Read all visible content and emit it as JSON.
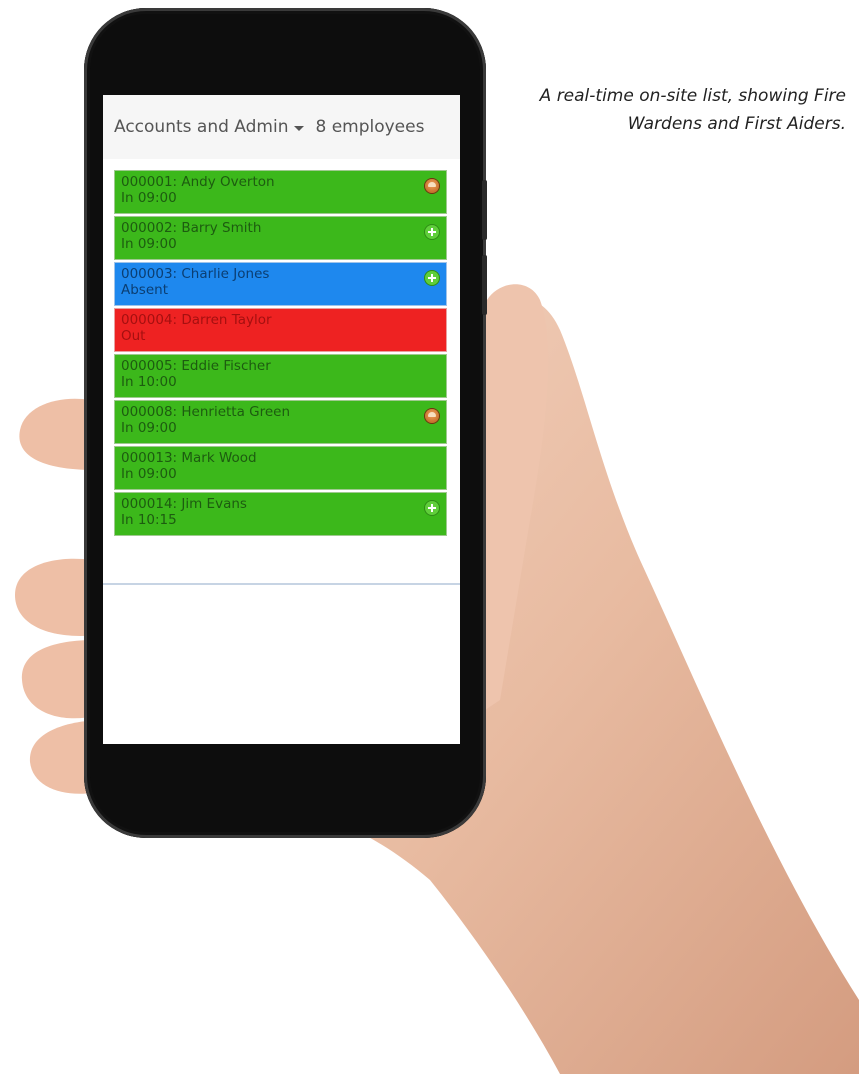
{
  "caption": "A real-time on-site list, showing Fire Wardens and First Aiders.",
  "header": {
    "department": "Accounts and Admin",
    "employee_count": "8 employees"
  },
  "employees": [
    {
      "name": "000001: Andy Overton",
      "status_text": "In 09:00",
      "state": "in",
      "role_icon": "fire-warden-icon"
    },
    {
      "name": "000002: Barry Smith",
      "status_text": "In 09:00",
      "state": "in",
      "role_icon": "first-aid-icon"
    },
    {
      "name": "000003: Charlie Jones",
      "status_text": "Absent",
      "state": "absent",
      "role_icon": "first-aid-icon"
    },
    {
      "name": "000004: Darren Taylor",
      "status_text": "Out",
      "state": "out",
      "role_icon": ""
    },
    {
      "name": "000005: Eddie Fischer",
      "status_text": "In 10:00",
      "state": "in",
      "role_icon": ""
    },
    {
      "name": "000008: Henrietta Green",
      "status_text": "In 09:00",
      "state": "in",
      "role_icon": "fire-warden-icon"
    },
    {
      "name": "000013: Mark Wood",
      "status_text": "In 09:00",
      "state": "in",
      "role_icon": ""
    },
    {
      "name": "000014: Jim Evans",
      "status_text": "In 10:15",
      "state": "in",
      "role_icon": "first-aid-icon"
    }
  ],
  "colors": {
    "in": "#3cb81b",
    "absent": "#1e88ee",
    "out": "#ee2222",
    "header_bg": "#f6f6f6",
    "phone_body": "#0d0d0d"
  }
}
